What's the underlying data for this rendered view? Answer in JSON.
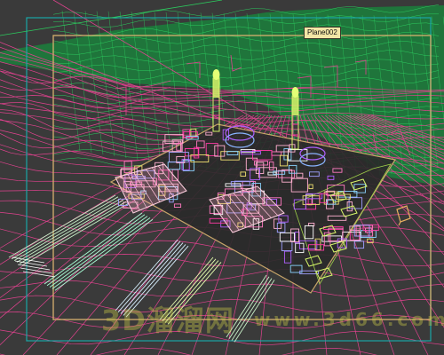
{
  "viewport": {
    "selected_object_label": "Plane002",
    "watermark_text": "3D溜溜网",
    "watermark_url": "www.3d66.com"
  },
  "colors": {
    "background": "#3a3a3a",
    "terrain_near": "#e0428e",
    "terrain_far": "#1fa84e",
    "safe_frame_outer": "#1aa6a6",
    "safe_frame_inner": "#d6b06e",
    "plant_outline": "#e8e8ff",
    "stack": "#d6f56a"
  },
  "icons": {
    "scene": "wireframe-power-plant",
    "selection": "selection-bracket-icon"
  }
}
